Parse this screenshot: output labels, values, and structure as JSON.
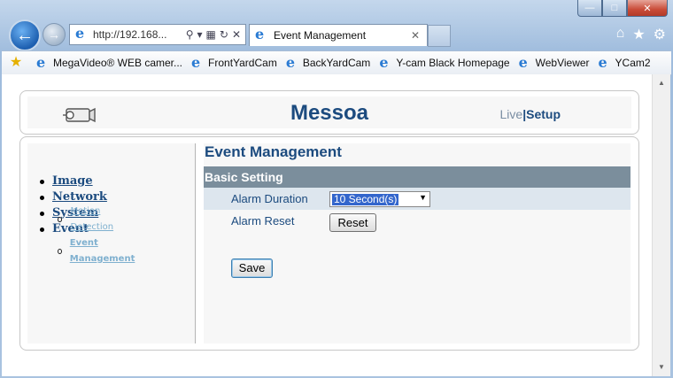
{
  "browser": {
    "address": "http://192.168...",
    "tab_title": "Event Management",
    "favorites": [
      {
        "label": "MegaVideo® WEB camer..."
      },
      {
        "label": "FrontYardCam"
      },
      {
        "label": "BackYardCam"
      },
      {
        "label": "Y-cam Black Homepage"
      },
      {
        "label": "WebViewer"
      },
      {
        "label": "YCam2"
      }
    ]
  },
  "header": {
    "brand": "Messoa",
    "live_label": "Live",
    "separator": "|",
    "setup_label": "Setup"
  },
  "sidebar": {
    "items": [
      {
        "label": "Image"
      },
      {
        "label": "Network"
      },
      {
        "label": "System"
      },
      {
        "label": "Event"
      }
    ],
    "event_subitems": [
      {
        "label": "Motion Detection"
      },
      {
        "label": "Event Management"
      }
    ]
  },
  "main": {
    "title": "Event Management",
    "section_title": "Basic Setting",
    "alarm_duration_label": "Alarm Duration",
    "alarm_duration_value": "10 Second(s)",
    "alarm_reset_label": "Alarm Reset",
    "reset_button": "Reset",
    "save_button": "Save"
  },
  "colors": {
    "brand_blue": "#1c4b7f",
    "section_bar": "#7b8e9c",
    "link_light": "#7fb0cf"
  }
}
